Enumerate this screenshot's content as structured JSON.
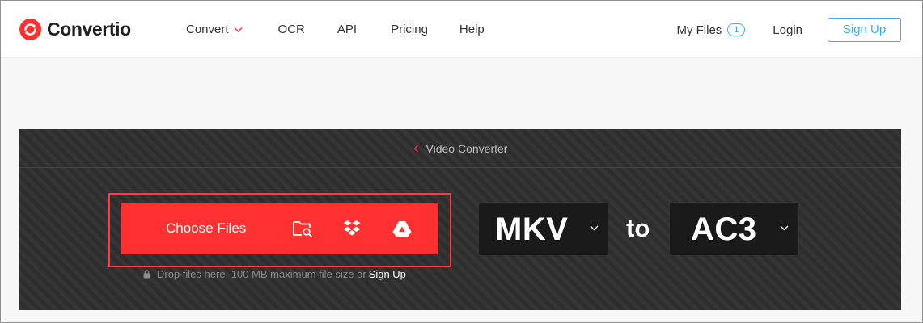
{
  "header": {
    "brand": "Convertio",
    "nav": [
      {
        "label": "Convert",
        "has_dropdown": true
      },
      {
        "label": "OCR"
      },
      {
        "label": "API"
      },
      {
        "label": "Pricing"
      },
      {
        "label": "Help"
      }
    ],
    "my_files": {
      "label": "My Files",
      "count": "1"
    },
    "login_label": "Login",
    "signup_label": "Sign Up"
  },
  "converter": {
    "breadcrumb": "Video Converter",
    "choose_files_label": "Choose Files",
    "sources": [
      "folder-search-icon",
      "dropbox-icon",
      "google-drive-icon"
    ],
    "hint_text": "Drop files here. 100 MB maximum file size or",
    "hint_link": "Sign Up",
    "from_format": "MKV",
    "to_word": "to",
    "to_format": "AC3"
  },
  "colors": {
    "brand_red": "#fe3030",
    "accent_blue": "#34b1ed",
    "panel_dark": "#2e2e2e",
    "format_box": "#1a1a1a"
  }
}
